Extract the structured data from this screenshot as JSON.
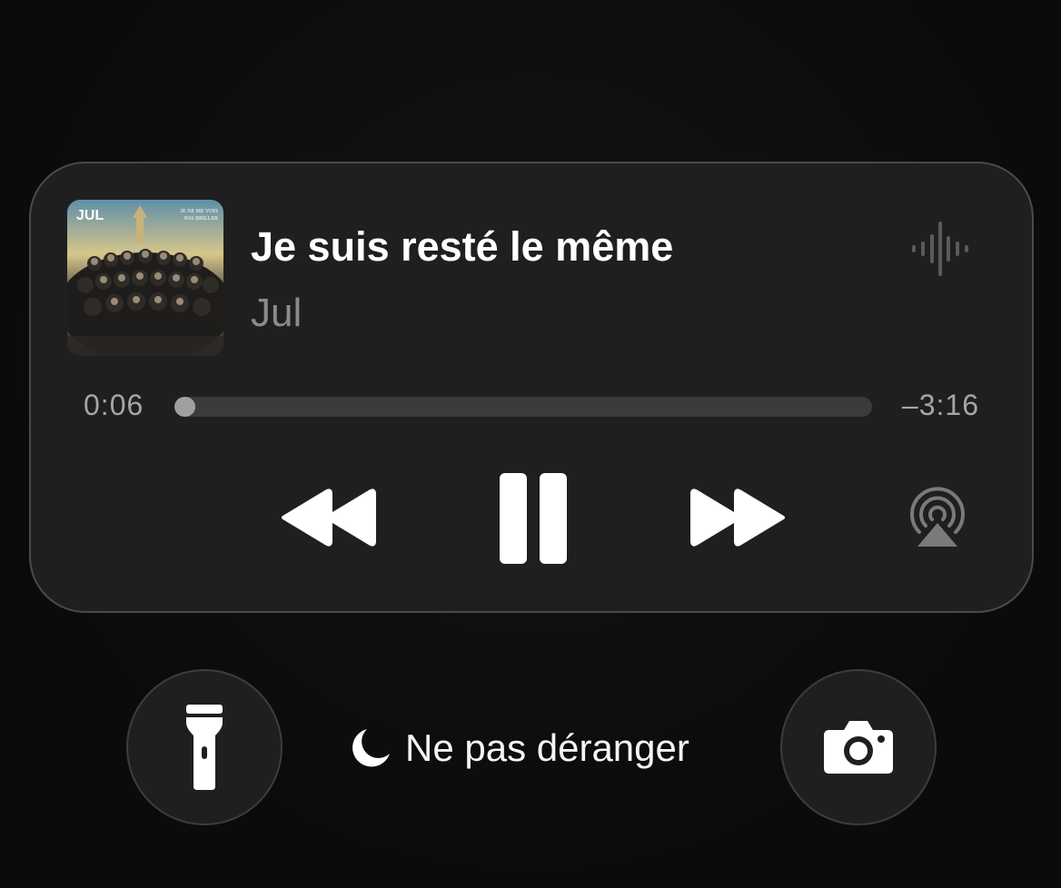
{
  "now_playing": {
    "title": "Je suis resté le même",
    "artist": "Jul",
    "artwork": {
      "logo_text": "JUL",
      "cover_text_line1": "JE NE ME VOIS",
      "cover_text_line2": "PAS BRILLER"
    },
    "elapsed": "0:06",
    "remaining": "–3:16",
    "progress_fraction": 0.03,
    "state": "playing",
    "icons": {
      "waveform": "waveform-icon",
      "rewind": "rewind-icon",
      "pause": "pause-icon",
      "forward": "fast-forward-icon",
      "airplay": "airplay-icon"
    }
  },
  "bottom_bar": {
    "left_icon": "flashlight-icon",
    "focus_icon": "moon-icon",
    "focus_label": "Ne pas déranger",
    "right_icon": "camera-icon"
  },
  "colors": {
    "background": "#0d0d0d",
    "card": "#1f1f20",
    "card_border": "#4a4a4c",
    "secondary_text": "#8b8b8d",
    "progress_track": "#3b3b3d",
    "progress_fill": "#a0a0a2"
  }
}
